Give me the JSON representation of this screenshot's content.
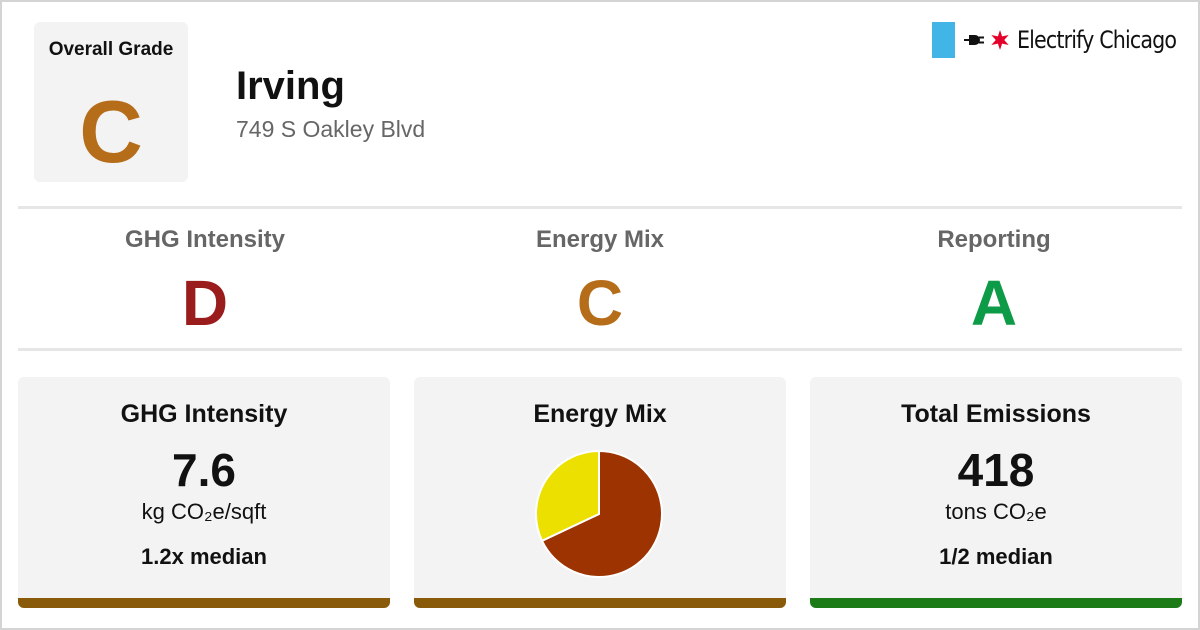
{
  "overall": {
    "label": "Overall Grade",
    "grade": "C"
  },
  "building": {
    "name": "Irving",
    "address": "749 S Oakley Blvd"
  },
  "logo": {
    "text": "Electrify Chicago",
    "icons": [
      "chicago-flag-bar",
      "plug-icon",
      "chicago-star-icon"
    ]
  },
  "grades": [
    {
      "label": "GHG Intensity",
      "grade": "D"
    },
    {
      "label": "Energy Mix",
      "grade": "C"
    },
    {
      "label": "Reporting",
      "grade": "A"
    }
  ],
  "cards": {
    "ghg_intensity": {
      "title": "GHG Intensity",
      "value": "7.6",
      "unit": "kg CO₂e/sqft",
      "median": "1.2x median"
    },
    "energy_mix": {
      "title": "Energy Mix"
    },
    "total_emissions": {
      "title": "Total Emissions",
      "value": "418",
      "unit": "tons CO₂e",
      "median": "1/2 median"
    }
  },
  "colors": {
    "grade_A": "#0e9b48",
    "grade_C": "#b66d19",
    "grade_D": "#9b1c1c",
    "bar_brown": "#8a5a0b",
    "bar_green": "#1c7a17",
    "pie_brown": "#9c3300",
    "pie_yellow": "#ece000",
    "logo_blue": "#41b6e6",
    "logo_red": "#e4002b"
  },
  "chart_data": {
    "type": "pie",
    "slices": [
      {
        "value": 68,
        "color": "#9c3300"
      },
      {
        "value": 32,
        "color": "#ece000"
      }
    ]
  }
}
